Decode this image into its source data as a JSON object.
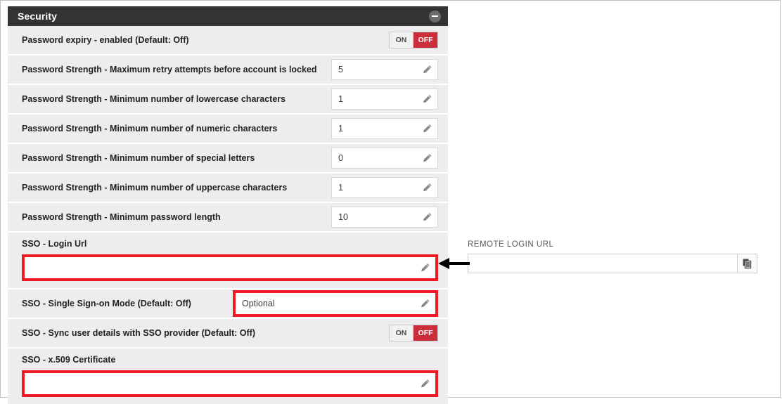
{
  "panel": {
    "title": "Security",
    "collapse_icon": "minus-circle-icon",
    "rows": [
      {
        "label": "Password expiry - enabled (Default: Off)",
        "type": "toggle",
        "on_label": "ON",
        "off_label": "OFF",
        "state": "OFF"
      },
      {
        "label": "Password Strength - Maximum retry attempts before account is locked",
        "type": "input",
        "value": "5"
      },
      {
        "label": "Password Strength - Minimum number of lowercase characters",
        "type": "input",
        "value": "1"
      },
      {
        "label": "Password Strength - Minimum number of numeric characters",
        "type": "input",
        "value": "1"
      },
      {
        "label": "Password Strength - Minimum number of special letters",
        "type": "input",
        "value": "0"
      },
      {
        "label": "Password Strength - Minimum number of uppercase characters",
        "type": "input",
        "value": "1"
      },
      {
        "label": "Password Strength - Minimum password length",
        "type": "input",
        "value": "10"
      },
      {
        "label": "SSO - Login Url",
        "type": "input-stacked",
        "value": "",
        "highlighted": true
      },
      {
        "label": "SSO - Single Sign-on Mode (Default: Off)",
        "type": "input",
        "value": "Optional",
        "highlighted": true
      },
      {
        "label": "SSO - Sync user details with SSO provider (Default: Off)",
        "type": "toggle",
        "on_label": "ON",
        "off_label": "OFF",
        "state": "OFF"
      },
      {
        "label": "SSO - x.509 Certificate",
        "type": "input-stacked",
        "value": "",
        "highlighted": true
      }
    ]
  },
  "remote": {
    "label": "REMOTE LOGIN URL",
    "value": "",
    "copy_icon": "copy-icon"
  },
  "annotation": {
    "arrow": "left-arrow-annotation",
    "highlight_color": "#ed1c24"
  },
  "colors": {
    "header_bg": "#333333",
    "row_bg": "#ededed",
    "toggle_off": "#cc2d3a",
    "annotation_red": "#ed1c24"
  }
}
